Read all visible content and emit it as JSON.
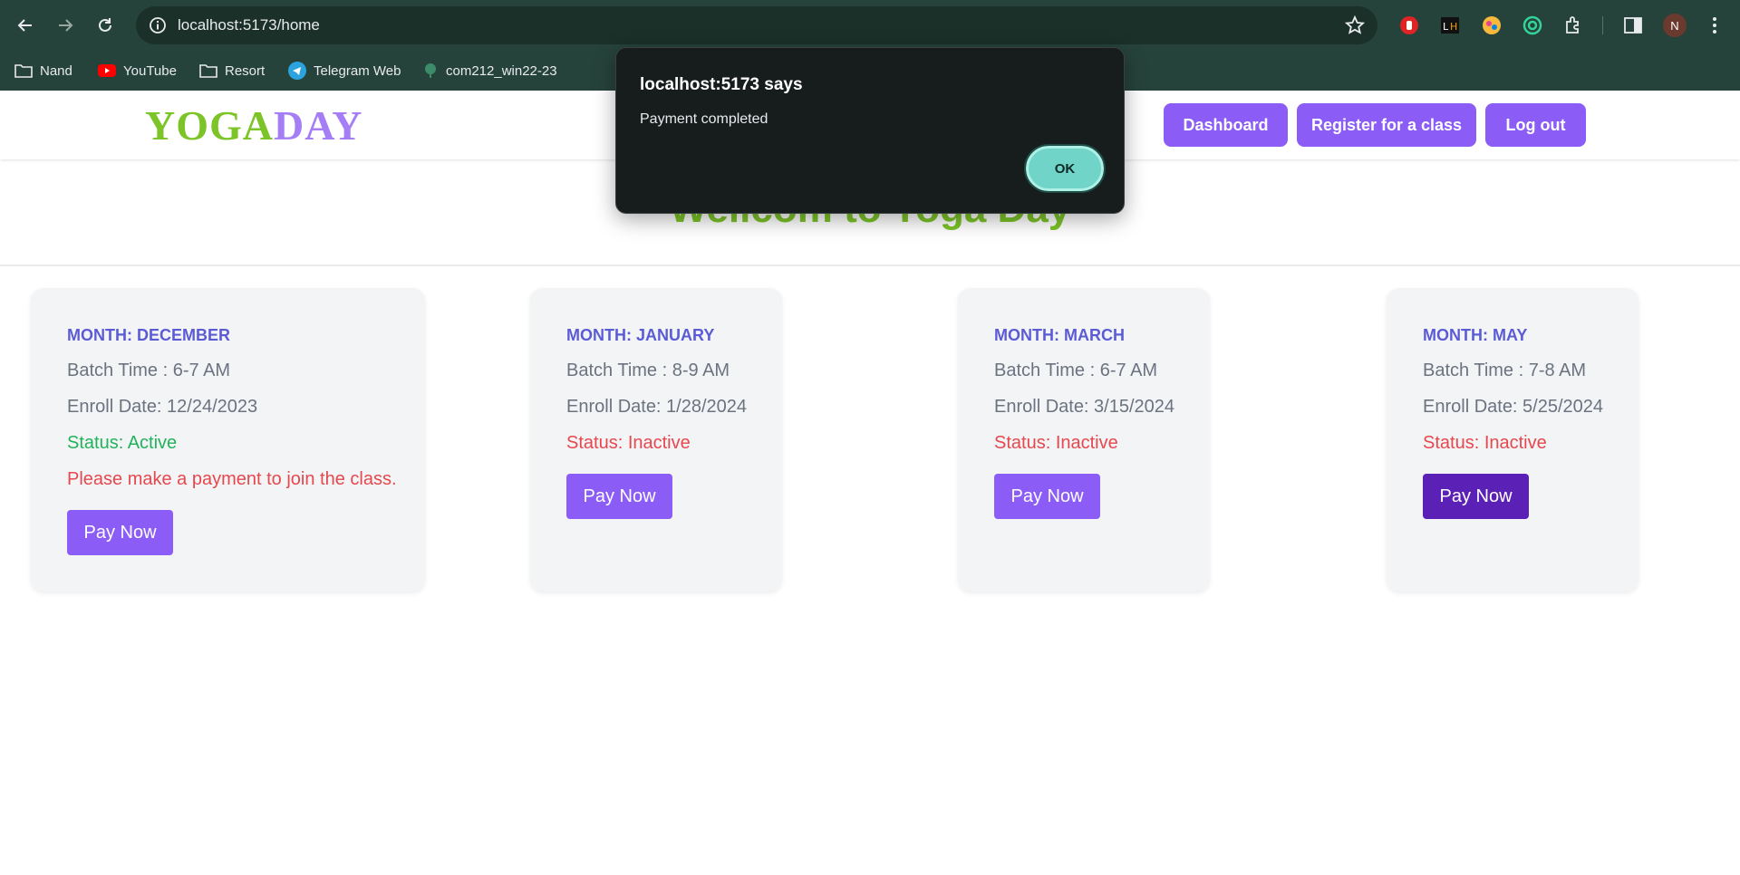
{
  "browser": {
    "url": "localhost:5173/home",
    "profile_initial": "N",
    "bookmarks": [
      "Nand",
      "YouTube",
      "Resort",
      "Telegram Web",
      "com212_win22-23"
    ]
  },
  "site": {
    "logo_part1": "YOGA",
    "logo_part2": "DAY",
    "nav": {
      "dashboard": "Dashboard",
      "register": "Register for a class",
      "logout": "Log out"
    },
    "hero_title": "Wellcom to Yoga Day"
  },
  "cards": [
    {
      "month": "MONTH: DECEMBER",
      "batch": "Batch Time : 6-7 AM",
      "enroll": "Enroll Date: 12/24/2023",
      "status": "Status: Active",
      "note": "Please make a payment to join the class.",
      "button": "Pay Now"
    },
    {
      "month": "MONTH: JANUARY",
      "batch": "Batch Time : 8-9 AM",
      "enroll": "Enroll Date: 1/28/2024",
      "status": "Status: Inactive",
      "button": "Pay Now"
    },
    {
      "month": "MONTH: MARCH",
      "batch": "Batch Time : 6-7 AM",
      "enroll": "Enroll Date: 3/15/2024",
      "status": "Status: Inactive",
      "button": "Pay Now"
    },
    {
      "month": "MONTH: MAY",
      "batch": "Batch Time : 7-8 AM",
      "enroll": "Enroll Date: 5/25/2024",
      "status": "Status: Inactive",
      "button": "Pay Now"
    }
  ],
  "dialog": {
    "title": "localhost:5173 says",
    "message": "Payment completed",
    "ok": "OK"
  },
  "colors": {
    "accent": "#8b5cf6",
    "logo_green": "#7cc427",
    "logo_purple": "#a57ef5",
    "status_active": "#22b35a",
    "status_inactive": "#e5484d",
    "chrome": "#26433b"
  }
}
